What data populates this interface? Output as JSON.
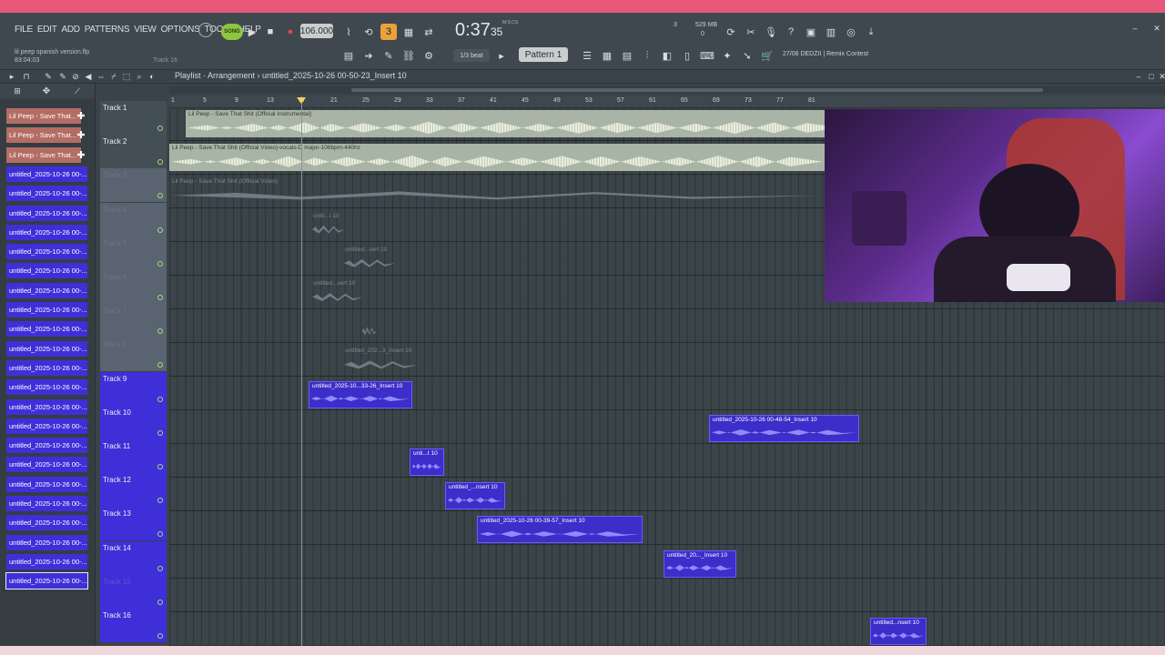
{
  "menu": [
    "FILE",
    "EDIT",
    "ADD",
    "PATTERNS",
    "VIEW",
    "OPTIONS",
    "TOOLS",
    "HELP"
  ],
  "project": {
    "file": "lil peep spanish version.flp",
    "time": "83:04:03",
    "track_hint": "Track 16"
  },
  "transport": {
    "song_label": "SONG",
    "tempo": "106.000",
    "time_main": "0:37",
    "time_sub": "35",
    "time_unit": "M:S:CS",
    "snap": "1/3 beat",
    "pattern": "Pattern 1",
    "cpu_value": "3",
    "ram": "529 MB",
    "ram_sub": "0"
  },
  "hint": "27/08  DEDZII | Remix Contest",
  "breadcrumb": "Playlist · Arrangement › untitled_2025-10-26 00-50-23_Insert 10",
  "ruler": [
    "1",
    "5",
    "9",
    "13",
    "17",
    "21",
    "25",
    "29",
    "33",
    "37",
    "41",
    "45",
    "49",
    "53",
    "57",
    "61",
    "65",
    "69",
    "73",
    "77",
    "81"
  ],
  "browser": [
    {
      "label": "Lil Peep - Save That...",
      "color": "orange"
    },
    {
      "label": "Lil Peep - Save That...",
      "color": "orange"
    },
    {
      "label": "Lil Peep - Save That...",
      "color": "orange"
    },
    {
      "label": "untitled_2025-10-26 00-...",
      "color": "blue"
    },
    {
      "label": "untitled_2025-10-26 00-...",
      "color": "blue"
    },
    {
      "label": "untitled_2025-10-26 00-...",
      "color": "blue"
    },
    {
      "label": "untitled_2025-10-26 00-...",
      "color": "blue"
    },
    {
      "label": "untitled_2025-10-26 00-...",
      "color": "blue"
    },
    {
      "label": "untitled_2025-10-26 00-...",
      "color": "blue"
    },
    {
      "label": "untitled_2025-10-26 00-...",
      "color": "blue"
    },
    {
      "label": "untitled_2025-10-26 00-...",
      "color": "blue"
    },
    {
      "label": "untitled_2025-10-26 00-...",
      "color": "blue"
    },
    {
      "label": "untitled_2025-10-26 00-...",
      "color": "blue"
    },
    {
      "label": "untitled_2025-10-26 00-...",
      "color": "blue"
    },
    {
      "label": "untitled_2025-10-26 00-...",
      "color": "blue"
    },
    {
      "label": "untitled_2025-10-26 00-...",
      "color": "blue"
    },
    {
      "label": "untitled_2025-10-26 00-...",
      "color": "blue"
    },
    {
      "label": "untitled_2025-10-26 00-...",
      "color": "blue"
    },
    {
      "label": "untitled_2025-10-26 00-...",
      "color": "blue"
    },
    {
      "label": "untitled_2025-10-26 00-...",
      "color": "blue"
    },
    {
      "label": "untitled_2025-10-26 00-...",
      "color": "blue"
    },
    {
      "label": "untitled_2025-10-26 00-...",
      "color": "blue"
    },
    {
      "label": "untitled_2025-10-26 00-...",
      "color": "blue"
    },
    {
      "label": "untitled_2025-10-26 00-...",
      "color": "blue"
    },
    {
      "label": "untitled_2025-10-26 00-...",
      "color": "blue"
    }
  ],
  "tracks": [
    {
      "name": "Track 1",
      "style": "plain"
    },
    {
      "name": "Track 2",
      "style": "plain"
    },
    {
      "name": "Track 3",
      "style": "dim"
    },
    {
      "name": "Track 4",
      "style": "dim"
    },
    {
      "name": "Track 5",
      "style": "dim"
    },
    {
      "name": "Track 6",
      "style": "dim"
    },
    {
      "name": "Track 7",
      "style": "dim"
    },
    {
      "name": "Track 8",
      "style": "dim"
    },
    {
      "name": "Track 9",
      "style": "blue"
    },
    {
      "name": "Track 10",
      "style": "blue"
    },
    {
      "name": "Track 11",
      "style": "blue"
    },
    {
      "name": "Track 12",
      "style": "blue"
    },
    {
      "name": "Track 13",
      "style": "blue"
    },
    {
      "name": "Track 14",
      "style": "blue"
    },
    {
      "name": "Track 15",
      "style": "blue-dim"
    },
    {
      "name": "Track 16",
      "style": "blue"
    }
  ],
  "clips": [
    {
      "track": 0,
      "label": "Lil Peep - Save That Shit (Official Instrumental)",
      "style": "ivory"
    },
    {
      "track": 1,
      "label": "Lil Peep - Save That Shit (Official Video)-vocals-D major-106bpm-440hz",
      "style": "ivory"
    },
    {
      "track": 2,
      "label": "Lil Peep - Save That Shit (Official Video)",
      "style": "ghost"
    },
    {
      "track": 3,
      "label": "untit...t 10",
      "style": "ghost"
    },
    {
      "track": 4,
      "label": "untitled...sert 10",
      "style": "ghost"
    },
    {
      "track": 5,
      "label": "untitled...sert 10",
      "style": "ghost"
    },
    {
      "track": 6,
      "label": "",
      "style": "ghost"
    },
    {
      "track": 7,
      "label": "untitled_202...3_Insert 10",
      "style": "ghost"
    },
    {
      "track": 8,
      "label": "untitled_2025-10...33-26_Insert 10",
      "style": "blue"
    },
    {
      "track": 9,
      "label": "untitled_2025-10-26 00-48-54_Insert 10",
      "style": "blue"
    },
    {
      "track": 10,
      "label": "unti...t 10",
      "style": "blue"
    },
    {
      "track": 11,
      "label": "untitled_...nsert 10",
      "style": "blue"
    },
    {
      "track": 12,
      "label": "untitled_2025-10-26 00-39-57_Insert 10",
      "style": "blue"
    },
    {
      "track": 13,
      "label": "untitled_20..._Insert 10",
      "style": "blue"
    },
    {
      "track": 15,
      "label": "untitled...nsert 10",
      "style": "blue"
    }
  ]
}
